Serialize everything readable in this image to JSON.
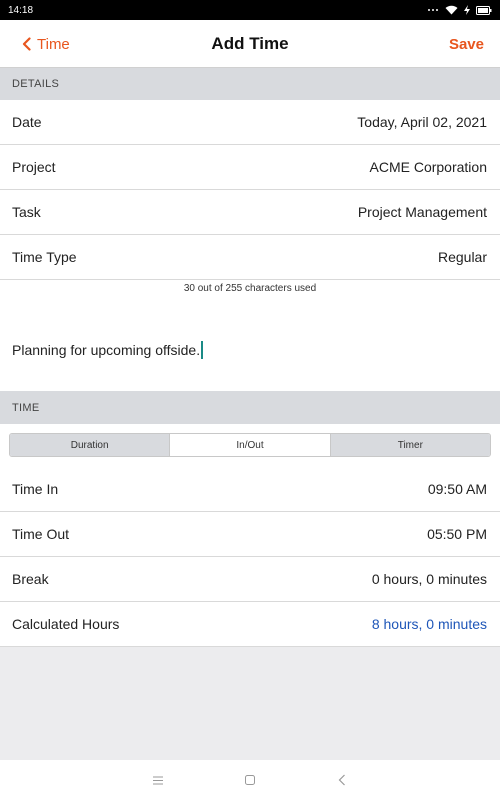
{
  "status_bar": {
    "time": "14:18"
  },
  "nav": {
    "back_label": "Time",
    "title": "Add Time",
    "save_label": "Save"
  },
  "details": {
    "header": "DETAILS",
    "rows": [
      {
        "label": "Date",
        "value": "Today, April 02, 2021"
      },
      {
        "label": "Project",
        "value": "ACME Corporation"
      },
      {
        "label": "Task",
        "value": "Project Management"
      },
      {
        "label": "Time Type",
        "value": "Regular"
      }
    ],
    "char_count": "30 out of 255 characters used",
    "notes": "Planning for upcoming offside."
  },
  "time": {
    "header": "TIME",
    "tabs": [
      {
        "label": "Duration",
        "active": false
      },
      {
        "label": "In/Out",
        "active": true
      },
      {
        "label": "Timer",
        "active": false
      }
    ],
    "rows": [
      {
        "label": "Time In",
        "value": "09:50 AM"
      },
      {
        "label": "Time Out",
        "value": "05:50 PM"
      },
      {
        "label": "Break",
        "value": "0 hours, 0 minutes"
      },
      {
        "label": "Calculated Hours",
        "value": "8 hours, 0 minutes"
      }
    ]
  },
  "colors": {
    "accent": "#e8561e",
    "link": "#1e56b8",
    "section_bg": "#d8dade"
  }
}
